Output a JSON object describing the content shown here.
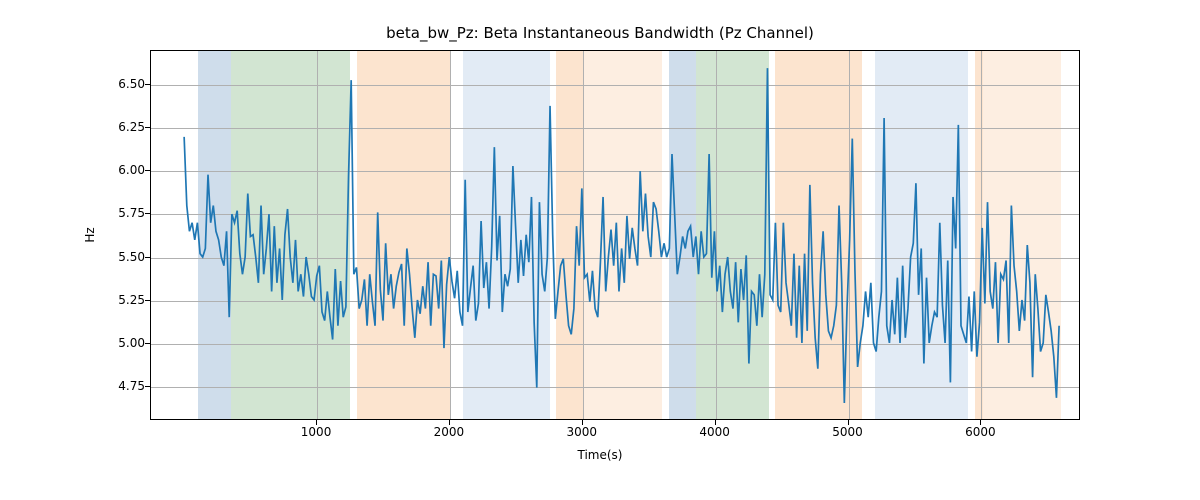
{
  "chart_data": {
    "type": "line",
    "title": "beta_bw_Pz: Beta Instantaneous Bandwidth (Pz Channel)",
    "xlabel": "Time(s)",
    "ylabel": "Hz",
    "xlim": [
      -250,
      6750
    ],
    "ylim": [
      4.55,
      6.7
    ],
    "x_ticks": [
      1000,
      2000,
      3000,
      4000,
      5000,
      6000
    ],
    "y_ticks": [
      4.75,
      5.0,
      5.25,
      5.5,
      5.75,
      6.0,
      6.25,
      6.5
    ],
    "y_tick_labels": [
      "4.75",
      "5.00",
      "5.25",
      "5.50",
      "5.75",
      "6.00",
      "6.25",
      "6.50"
    ],
    "bands": [
      {
        "x0": 100,
        "x1": 350,
        "color": "#5f8fbc"
      },
      {
        "x0": 350,
        "x1": 1250,
        "color": "#6aaa6a"
      },
      {
        "x0": 1300,
        "x1": 2000,
        "color": "#f4a460"
      },
      {
        "x0": 2100,
        "x1": 2750,
        "color": "#9fbedf"
      },
      {
        "x0": 2800,
        "x1": 3000,
        "color": "#f4a460"
      },
      {
        "x0": 3000,
        "x1": 3600,
        "color": "#f8c89a"
      },
      {
        "x0": 3650,
        "x1": 3850,
        "color": "#5f8fbc"
      },
      {
        "x0": 3850,
        "x1": 4400,
        "color": "#6aaa6a"
      },
      {
        "x0": 4450,
        "x1": 5100,
        "color": "#f4a460"
      },
      {
        "x0": 5200,
        "x1": 5900,
        "color": "#9fbedf"
      },
      {
        "x0": 5950,
        "x1": 6010,
        "color": "#f4a460"
      },
      {
        "x0": 6010,
        "x1": 6600,
        "color": "#f8c89a"
      }
    ],
    "x": [
      0,
      20,
      40,
      60,
      80,
      100,
      120,
      140,
      160,
      180,
      200,
      220,
      240,
      260,
      280,
      300,
      320,
      340,
      360,
      380,
      400,
      420,
      440,
      460,
      480,
      500,
      520,
      540,
      560,
      580,
      600,
      620,
      640,
      660,
      680,
      700,
      720,
      740,
      760,
      780,
      800,
      820,
      840,
      860,
      880,
      900,
      920,
      940,
      960,
      980,
      1000,
      1020,
      1040,
      1060,
      1080,
      1100,
      1120,
      1140,
      1160,
      1180,
      1200,
      1220,
      1240,
      1260,
      1280,
      1300,
      1320,
      1340,
      1360,
      1380,
      1400,
      1420,
      1440,
      1460,
      1480,
      1500,
      1520,
      1540,
      1560,
      1580,
      1600,
      1620,
      1640,
      1660,
      1680,
      1700,
      1720,
      1740,
      1760,
      1780,
      1800,
      1820,
      1840,
      1860,
      1880,
      1900,
      1920,
      1940,
      1960,
      1980,
      2000,
      2020,
      2040,
      2060,
      2080,
      2100,
      2120,
      2140,
      2160,
      2180,
      2200,
      2220,
      2240,
      2260,
      2280,
      2300,
      2320,
      2340,
      2360,
      2380,
      2400,
      2420,
      2440,
      2460,
      2480,
      2500,
      2520,
      2540,
      2560,
      2580,
      2600,
      2620,
      2640,
      2660,
      2680,
      2700,
      2720,
      2740,
      2760,
      2780,
      2800,
      2820,
      2840,
      2860,
      2880,
      2900,
      2920,
      2940,
      2960,
      2980,
      3000,
      3020,
      3040,
      3060,
      3080,
      3100,
      3120,
      3140,
      3160,
      3180,
      3200,
      3220,
      3240,
      3260,
      3280,
      3300,
      3320,
      3340,
      3360,
      3380,
      3400,
      3420,
      3440,
      3460,
      3480,
      3500,
      3520,
      3540,
      3560,
      3580,
      3600,
      3620,
      3640,
      3660,
      3680,
      3700,
      3720,
      3740,
      3760,
      3780,
      3800,
      3820,
      3840,
      3860,
      3880,
      3900,
      3920,
      3940,
      3960,
      3980,
      4000,
      4020,
      4040,
      4060,
      4080,
      4100,
      4120,
      4140,
      4160,
      4180,
      4200,
      4220,
      4240,
      4260,
      4280,
      4300,
      4320,
      4340,
      4360,
      4380,
      4400,
      4420,
      4440,
      4460,
      4480,
      4500,
      4520,
      4540,
      4560,
      4580,
      4600,
      4620,
      4640,
      4660,
      4680,
      4700,
      4720,
      4740,
      4760,
      4780,
      4800,
      4820,
      4840,
      4860,
      4880,
      4900,
      4920,
      4940,
      4960,
      4980,
      5000,
      5020,
      5040,
      5060,
      5080,
      5100,
      5120,
      5140,
      5160,
      5180,
      5200,
      5220,
      5240,
      5260,
      5280,
      5300,
      5320,
      5340,
      5360,
      5380,
      5400,
      5420,
      5440,
      5460,
      5480,
      5500,
      5520,
      5540,
      5560,
      5580,
      5600,
      5620,
      5640,
      5660,
      5680,
      5700,
      5720,
      5740,
      5760,
      5780,
      5800,
      5820,
      5840,
      5860,
      5880,
      5900,
      5920,
      5940,
      5960,
      5980,
      6000,
      6020,
      6040,
      6060,
      6080,
      6100,
      6120,
      6140,
      6160,
      6180,
      6200,
      6220,
      6240,
      6260,
      6280,
      6300,
      6320,
      6340,
      6360,
      6380,
      6400,
      6420,
      6440,
      6460,
      6480,
      6500,
      6520,
      6540,
      6560,
      6580,
      6600
    ],
    "values": [
      6.2,
      5.8,
      5.65,
      5.7,
      5.6,
      5.7,
      5.52,
      5.5,
      5.55,
      5.98,
      5.7,
      5.8,
      5.65,
      5.6,
      5.5,
      5.45,
      5.65,
      5.15,
      5.75,
      5.7,
      5.77,
      5.52,
      5.4,
      5.5,
      5.87,
      5.62,
      5.63,
      5.5,
      5.35,
      5.8,
      5.4,
      5.55,
      5.75,
      5.3,
      5.68,
      5.35,
      5.55,
      5.25,
      5.63,
      5.78,
      5.5,
      5.35,
      5.6,
      5.3,
      5.4,
      5.27,
      5.5,
      5.4,
      5.27,
      5.25,
      5.39,
      5.45,
      5.18,
      5.13,
      5.3,
      5.15,
      5.02,
      5.43,
      5.1,
      5.36,
      5.15,
      5.21,
      5.97,
      6.53,
      5.4,
      5.44,
      5.2,
      5.25,
      5.37,
      5.1,
      5.4,
      5.24,
      5.1,
      5.76,
      5.31,
      5.13,
      5.58,
      5.28,
      5.4,
      5.2,
      5.33,
      5.41,
      5.46,
      5.1,
      5.55,
      5.4,
      5.2,
      5.03,
      5.25,
      5.17,
      5.33,
      5.2,
      5.47,
      5.1,
      5.4,
      5.39,
      5.2,
      5.48,
      4.97,
      5.34,
      5.5,
      5.36,
      5.26,
      5.42,
      5.18,
      5.1,
      5.95,
      5.18,
      5.32,
      5.45,
      5.13,
      5.23,
      5.71,
      5.32,
      5.47,
      5.2,
      5.56,
      6.14,
      5.48,
      5.74,
      5.18,
      5.4,
      5.33,
      5.43,
      6.03,
      5.68,
      5.35,
      5.6,
      5.39,
      5.63,
      5.47,
      5.85,
      5.12,
      4.74,
      5.82,
      5.4,
      5.3,
      5.5,
      6.38,
      5.63,
      5.14,
      5.3,
      5.45,
      5.49,
      5.28,
      5.1,
      5.05,
      5.2,
      5.68,
      5.45,
      5.9,
      5.38,
      5.4,
      5.24,
      5.42,
      5.2,
      5.15,
      5.47,
      5.85,
      5.3,
      5.5,
      5.66,
      5.45,
      5.7,
      5.3,
      5.55,
      5.35,
      5.74,
      5.49,
      5.67,
      5.55,
      5.45,
      6.0,
      5.65,
      5.87,
      5.62,
      5.5,
      5.82,
      5.78,
      5.65,
      5.5,
      5.58,
      5.5,
      5.55,
      6.1,
      5.75,
      5.4,
      5.5,
      5.62,
      5.55,
      5.65,
      5.68,
      5.5,
      5.62,
      5.4,
      5.65,
      5.5,
      5.52,
      6.1,
      5.38,
      5.65,
      5.3,
      5.45,
      5.18,
      5.4,
      5.5,
      5.3,
      5.2,
      5.47,
      5.12,
      5.43,
      5.25,
      5.51,
      4.88,
      5.3,
      5.28,
      5.1,
      5.4,
      5.15,
      5.4,
      6.6,
      5.28,
      5.25,
      5.7,
      5.22,
      5.18,
      5.7,
      5.35,
      5.23,
      5.1,
      5.52,
      5.03,
      5.45,
      5.0,
      5.52,
      5.07,
      5.92,
      5.35,
      5.03,
      4.85,
      5.4,
      5.65,
      5.28,
      5.07,
      5.03,
      5.1,
      5.22,
      5.8,
      5.35,
      4.65,
      5.2,
      5.6,
      6.19,
      5.42,
      4.86,
      5.0,
      5.1,
      5.3,
      5.15,
      5.35,
      5.0,
      4.95,
      5.15,
      5.3,
      6.31,
      5.1,
      5.0,
      5.25,
      5.05,
      5.38,
      5.0,
      5.45,
      5.03,
      5.2,
      5.5,
      5.58,
      5.93,
      5.28,
      5.55,
      4.88,
      5.38,
      5.0,
      5.1,
      5.18,
      5.15,
      5.7,
      5.22,
      5.0,
      5.48,
      4.77,
      5.85,
      5.55,
      6.27,
      5.1,
      5.05,
      5.0,
      5.27,
      4.95,
      5.3,
      4.92,
      5.12,
      5.67,
      5.23,
      5.82,
      5.3,
      5.2,
      5.47,
      5.0,
      5.4,
      5.37,
      5.48,
      5.0,
      5.8,
      5.45,
      5.3,
      5.07,
      5.25,
      5.13,
      5.57,
      5.35,
      4.8,
      5.4,
      5.2,
      4.95,
      5.0,
      5.28,
      5.18,
      5.07,
      4.92,
      4.68,
      5.1
    ]
  }
}
